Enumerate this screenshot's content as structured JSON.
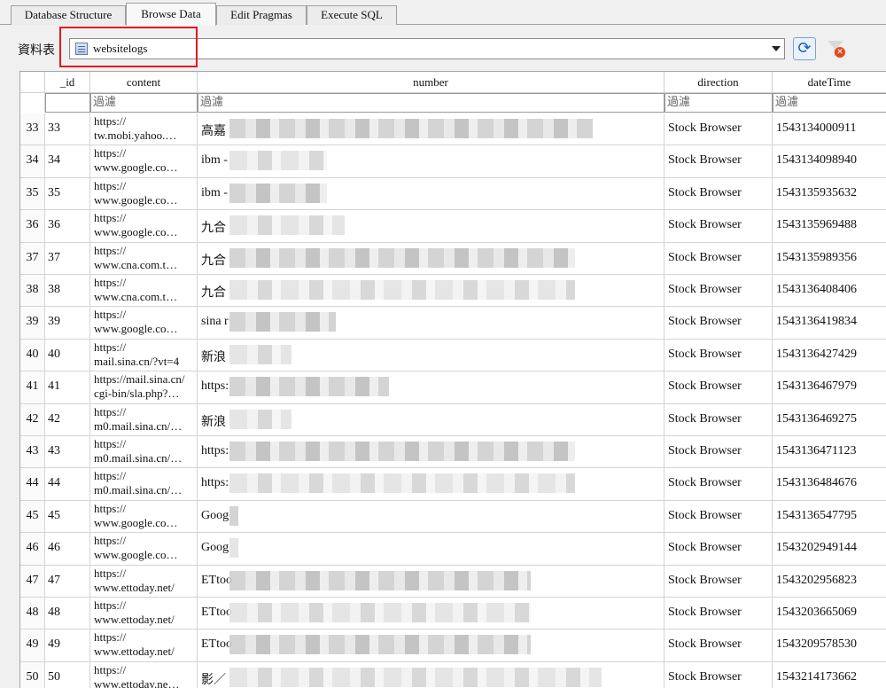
{
  "tabs": [
    {
      "label": "Database Structure",
      "active": false
    },
    {
      "label": "Browse Data",
      "active": true
    },
    {
      "label": "Edit Pragmas",
      "active": false
    },
    {
      "label": "Execute SQL",
      "active": false
    }
  ],
  "table_selector": {
    "label": "資料表",
    "selected": "websitelogs",
    "highlight_color": "#e21a22"
  },
  "columns": [
    "_id",
    "content",
    "number",
    "direction",
    "dateTime"
  ],
  "filter_placeholder": "過濾",
  "rows": [
    {
      "rownum": "33",
      "id": "33",
      "content": "https://\ntw.mobi.yahoo.…",
      "number": "高嘉",
      "direction": "Stock Browser",
      "dateTime": "1543134000911"
    },
    {
      "rownum": "34",
      "id": "34",
      "content": "https://\nwww.google.co…",
      "number": "ibm -",
      "direction": "Stock Browser",
      "dateTime": "1543134098940"
    },
    {
      "rownum": "35",
      "id": "35",
      "content": "https://\nwww.google.co…",
      "number": "ibm -",
      "direction": "Stock Browser",
      "dateTime": "1543135935632"
    },
    {
      "rownum": "36",
      "id": "36",
      "content": "https://\nwww.google.co…",
      "number": "九合",
      "direction": "Stock Browser",
      "dateTime": "1543135969488"
    },
    {
      "rownum": "37",
      "id": "37",
      "content": "https://\nwww.cna.com.t…",
      "number": "九合",
      "direction": "Stock Browser",
      "dateTime": "1543135989356"
    },
    {
      "rownum": "38",
      "id": "38",
      "content": "https://\nwww.cna.com.t…",
      "number": "九合",
      "direction": "Stock Browser",
      "dateTime": "1543136408406"
    },
    {
      "rownum": "39",
      "id": "39",
      "content": "https://\nwww.google.co…",
      "number": "sina r",
      "direction": "Stock Browser",
      "dateTime": "1543136419834"
    },
    {
      "rownum": "40",
      "id": "40",
      "content": "https://\nmail.sina.cn/?vt=4",
      "number": "新浪",
      "direction": "Stock Browser",
      "dateTime": "1543136427429"
    },
    {
      "rownum": "41",
      "id": "41",
      "content": "https://mail.sina.cn/\ncgi-bin/sla.php?…",
      "number": "https:",
      "direction": "Stock Browser",
      "dateTime": "1543136467979"
    },
    {
      "rownum": "42",
      "id": "42",
      "content": "https://\nm0.mail.sina.cn/…",
      "number": "新浪",
      "direction": "Stock Browser",
      "dateTime": "1543136469275"
    },
    {
      "rownum": "43",
      "id": "43",
      "content": "https://\nm0.mail.sina.cn/…",
      "number": "https:",
      "direction": "Stock Browser",
      "dateTime": "1543136471123"
    },
    {
      "rownum": "44",
      "id": "44",
      "content": "https://\nm0.mail.sina.cn/…",
      "number": "https:",
      "direction": "Stock Browser",
      "dateTime": "1543136484676"
    },
    {
      "rownum": "45",
      "id": "45",
      "content": "https://\nwww.google.co…",
      "number": "Goog",
      "direction": "Stock Browser",
      "dateTime": "1543136547795"
    },
    {
      "rownum": "46",
      "id": "46",
      "content": "https://\nwww.google.co…",
      "number": "Goog",
      "direction": "Stock Browser",
      "dateTime": "1543202949144"
    },
    {
      "rownum": "47",
      "id": "47",
      "content": "https://\nwww.ettoday.net/",
      "number": "ETtoo",
      "direction": "Stock Browser",
      "dateTime": "1543202956823"
    },
    {
      "rownum": "48",
      "id": "48",
      "content": "https://\nwww.ettoday.net/",
      "number": "ETtoo",
      "direction": "Stock Browser",
      "dateTime": "1543203665069"
    },
    {
      "rownum": "49",
      "id": "49",
      "content": "https://\nwww.ettoday.net/",
      "number": "ETtoo",
      "direction": "Stock Browser",
      "dateTime": "1543209578530"
    },
    {
      "rownum": "50",
      "id": "50",
      "content": "https://\nwww.ettoday.ne…",
      "number": "影／",
      "direction": "Stock Browser",
      "dateTime": "1543214173662"
    }
  ]
}
